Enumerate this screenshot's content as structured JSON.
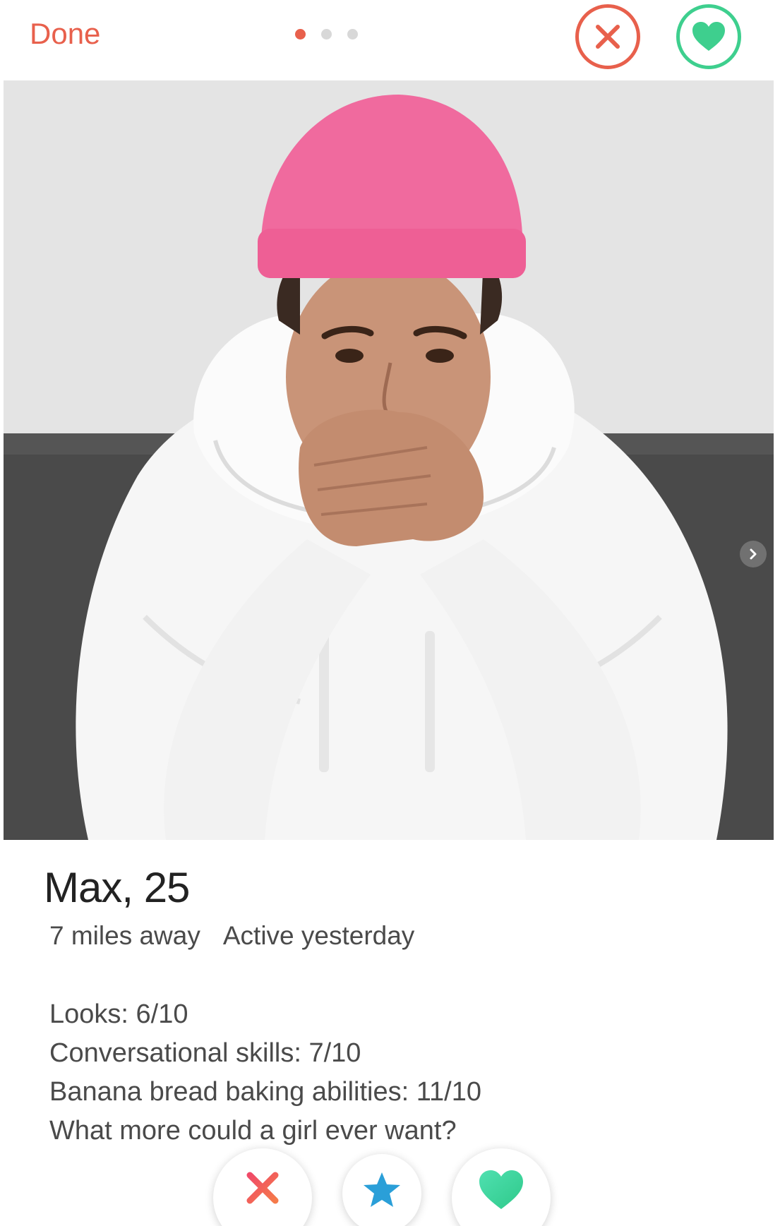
{
  "header": {
    "done_label": "Done",
    "photo_count": 3,
    "active_photo_index": 0
  },
  "profile": {
    "name_age": "Max, 25",
    "distance": "7 miles away",
    "activity": "Active yesterday",
    "bio": [
      "Looks: 6/10",
      "Conversational skills: 7/10",
      "Banana bread baking abilities: 11/10",
      "What more could a girl ever want?"
    ]
  },
  "colors": {
    "nope": "#e8604c",
    "like": "#3ecf8e",
    "super_like": "#2a9fd8",
    "beanie": "#f06a9e",
    "hoodie": "#f7f7f7",
    "wall": "#e3e3e3",
    "couch": "#4a4a4a"
  },
  "icons": {
    "nope": "close-icon",
    "like": "heart-icon",
    "super_like": "star-icon",
    "next_photo": "chevron-right-icon"
  }
}
